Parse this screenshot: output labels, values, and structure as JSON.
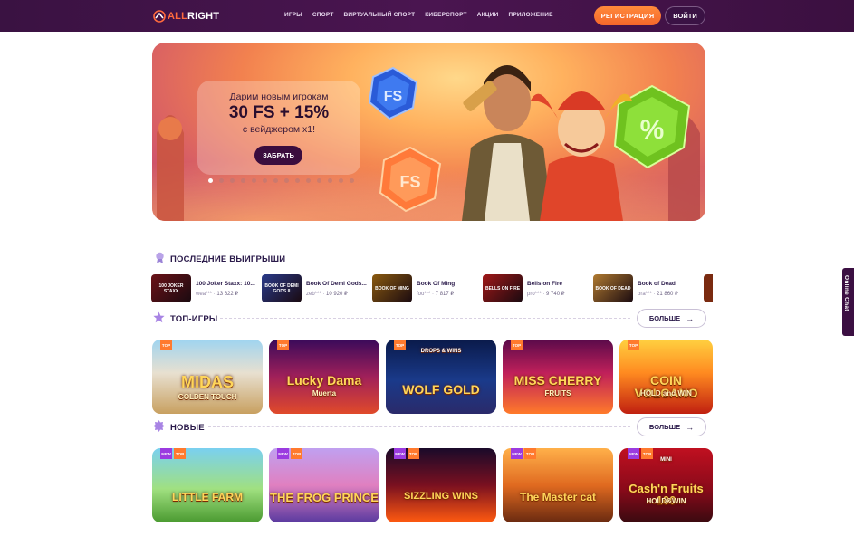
{
  "header": {
    "logo_prefix": "ALL",
    "logo_suffix": "RIGHT",
    "nav": [
      "ИГРЫ",
      "СПОРТ",
      "ВИРТУАЛЬНЫЙ СПОРТ",
      "КИБЕРСПОРТ",
      "АКЦИИ",
      "ПРИЛОЖЕНИЕ"
    ],
    "register_label": "РЕГИСТРАЦИЯ",
    "login_label": "ВОЙТИ"
  },
  "banner": {
    "line1": "Дарим новым игрокам",
    "big": "30 FS + 15%",
    "line3": "с вейджером x1!",
    "cta": "ЗАБРАТЬ",
    "gem_left": "FS",
    "gem_right": "FS",
    "gem_percent": "%",
    "slide_count": 14,
    "active_slide": 1
  },
  "winners": {
    "title": "ПОСЛЕДНИЕ ВЫИГРЫШИ",
    "items": [
      {
        "game": "100 Joker Staxx: 10...",
        "user": "wea***",
        "amount": "13 622 ₽",
        "thumb": "100 JOKER STAXX",
        "thumb_color": "#6a1218"
      },
      {
        "game": "Book Of Demi Gods...",
        "user": "zeb***",
        "amount": "10 920 ₽",
        "thumb": "BOOK OF DEMI GODS II",
        "thumb_color": "#2a3a8a"
      },
      {
        "game": "Book Of Ming",
        "user": "foo***",
        "amount": "7 817 ₽",
        "thumb": "BOOK OF MING",
        "thumb_color": "#8a5a10"
      },
      {
        "game": "Bells on Fire",
        "user": "pro***",
        "amount": "9 740 ₽",
        "thumb": "BELLS ON FIRE",
        "thumb_color": "#a01818"
      },
      {
        "game": "Book of Dead",
        "user": "bra***",
        "amount": "21 860 ₽",
        "thumb": "BOOK OF DEAD",
        "thumb_color": "#b07a30"
      }
    ]
  },
  "top_games": {
    "title": "ТОП-ИГРЫ",
    "more_label": "БОЛЬШЕ",
    "badge": "TOP",
    "items": [
      {
        "title": "MIDAS",
        "subtitle": "GOLDEN TOUCH"
      },
      {
        "title": "Lucky Dama",
        "subtitle": "Muerta"
      },
      {
        "title": "WOLF GOLD",
        "subtitle": "",
        "tag": "DROPS & WINS"
      },
      {
        "title": "MISS CHERRY",
        "subtitle": "FRUITS"
      },
      {
        "title": "COIN VOLCANO",
        "subtitle": "HOLD and WIN"
      }
    ]
  },
  "new_games": {
    "title": "НОВЫЕ",
    "more_label": "БОЛЬШЕ",
    "badge_new": "NEW",
    "badge_top": "TOP",
    "items": [
      {
        "title": "LITTLE FARM"
      },
      {
        "title": "THE FROG PRINCE"
      },
      {
        "title": "SIZZLING WINS"
      },
      {
        "title": "The Master cat"
      },
      {
        "title": "Cash'n Fruits 100",
        "subtitle": "HOLD&WIN",
        "tag": "MINI"
      }
    ]
  },
  "chat": {
    "label": "Online Chat"
  }
}
